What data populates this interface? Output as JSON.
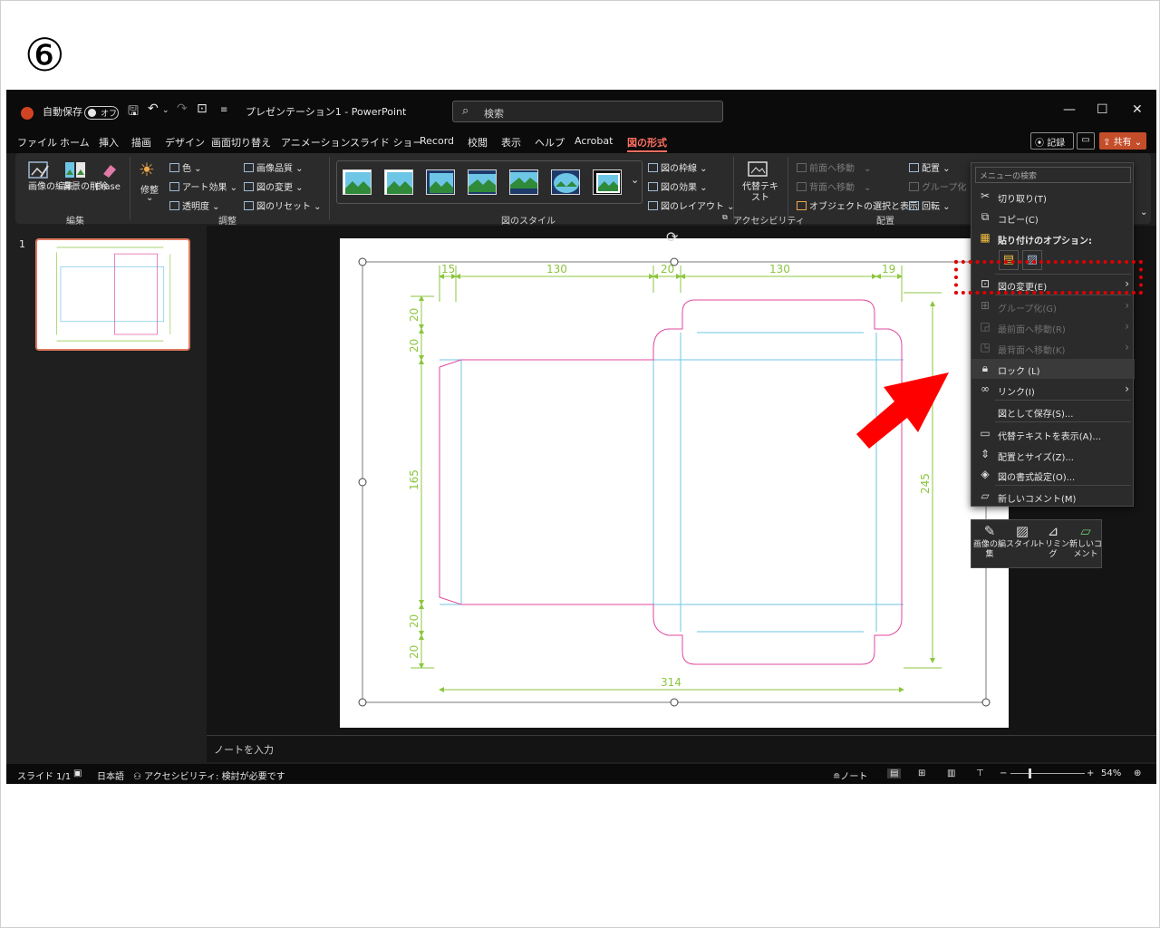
{
  "step_label": "⑥",
  "window": {
    "autosave_label": "自動保存",
    "autosave_state": "オフ",
    "doc_title": "プレゼンテーション1 - PowerPoint",
    "search_placeholder": "検索"
  },
  "tabs": [
    "ファイル",
    "ホーム",
    "挿入",
    "描画",
    "デザイン",
    "画面切り替え",
    "アニメーション",
    "スライド ショー",
    "Record",
    "校閲",
    "表示",
    "ヘルプ",
    "Acrobat",
    "図の形式"
  ],
  "active_tab": "図の形式",
  "header_buttons": {
    "record": "記録",
    "share": "共有"
  },
  "ribbon": {
    "edit_group": {
      "label": "編集",
      "items": [
        "画像の編集",
        "背景の削除",
        "Erase"
      ]
    },
    "adjust_group": {
      "label": "調整",
      "corrections": "修整",
      "color": "色",
      "artistic": "アート効果",
      "transparency": "透明度",
      "compress": "画像品質",
      "change": "図の変更",
      "reset": "図のリセット"
    },
    "styles_group": {
      "label": "図のスタイル",
      "border": "図の枠線",
      "effects": "図の効果",
      "layout": "図のレイアウト"
    },
    "accessibility_group": {
      "label": "アクセシビリティ",
      "alt_text": "代替テキスト"
    },
    "arrange_group": {
      "label": "配置",
      "bring_forward": "前面へ移動",
      "send_backward": "背面へ移動",
      "selection_pane": "オブジェクトの選択と表示",
      "align": "配置",
      "group": "グループ化",
      "rotate": "回転"
    }
  },
  "thumbnail_pane": {
    "slide_number": "1"
  },
  "drawing": {
    "dims_top": [
      "15",
      "130",
      "20",
      "130",
      "19"
    ],
    "dims_left": [
      "20",
      "20",
      "165",
      "20",
      "20"
    ],
    "dim_right": "245",
    "dim_bottom": "314",
    "line_colors": {
      "dimension": "#8cc63f",
      "cut": "#e0479e",
      "fold": "#6ec6e6"
    }
  },
  "notes_placeholder": "ノートを入力",
  "context_menu": {
    "search_placeholder": "メニューの検索",
    "items": [
      {
        "icon": "cut-icon",
        "label": "切り取り(T)"
      },
      {
        "icon": "copy-icon",
        "label": "コピー(C)"
      },
      {
        "icon": "paste-icon",
        "label": "貼り付けのオプション:"
      },
      {
        "icon": "change-picture-icon",
        "label": "図の変更(E)"
      },
      {
        "icon": "group-icon",
        "label": "グループ化(G)"
      },
      {
        "icon": "bring-front-icon",
        "label": "最前面へ移動(R)"
      },
      {
        "icon": "send-back-icon",
        "label": "最背面へ移動(K)"
      },
      {
        "icon": "lock-icon",
        "label": "ロック (L)"
      },
      {
        "icon": "link-icon",
        "label": "リンク(I)"
      },
      {
        "icon": "",
        "label": "図として保存(S)..."
      },
      {
        "icon": "alt-text-icon",
        "label": "代替テキストを表示(A)..."
      },
      {
        "icon": "size-position-icon",
        "label": "配置とサイズ(Z)..."
      },
      {
        "icon": "format-picture-icon",
        "label": "図の書式設定(O)..."
      },
      {
        "icon": "new-comment-icon",
        "label": "新しいコメント(M)"
      }
    ]
  },
  "mini_toolbar": [
    "画像の編集",
    "スタイル",
    "トリミング",
    "新しいコメント"
  ],
  "status_bar": {
    "slide_info": "スライド 1/1",
    "language": "日本語",
    "accessibility": "アクセシビリティ: 検討が必要です",
    "notes": "ノート",
    "zoom": "54%"
  }
}
